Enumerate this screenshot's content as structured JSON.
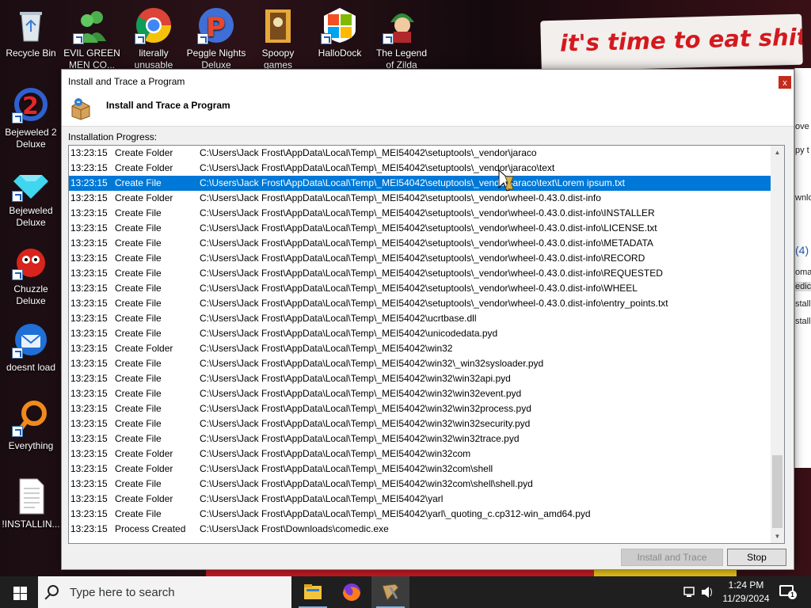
{
  "desktop": {
    "wallpaper_text": "it's time to eat shit",
    "icons": [
      {
        "label": "Recycle Bin"
      },
      {
        "label": "EVIL GREEN MEN CO..."
      },
      {
        "label": "literally unusable"
      },
      {
        "label": "Peggle Nights Deluxe"
      },
      {
        "label": "Spoopy games"
      },
      {
        "label": "HalloDock"
      },
      {
        "label": "The Legend of Zilda"
      },
      {
        "label": "Bejeweled 2 Deluxe"
      },
      {
        "label": "Bejeweled Deluxe"
      },
      {
        "label": "Chuzzle Deluxe"
      },
      {
        "label": "doesnt load"
      },
      {
        "label": "Everything"
      },
      {
        "label": "!INSTALLIN..."
      }
    ],
    "bg_window_fragments": [
      "ove t",
      "py t",
      "wnlo",
      "(4)",
      "oma",
      "edic",
      "stall",
      "stall"
    ]
  },
  "dialog": {
    "title": "Install and Trace a Program",
    "close_label": "x",
    "header_title": "Install and Trace a Program",
    "progress_label": "Installation Progress:",
    "selected_index": 2,
    "rows": [
      [
        "13:23:15",
        "Create Folder",
        "C:\\Users\\Jack Frost\\AppData\\Local\\Temp\\_MEI54042\\setuptools\\_vendor\\jaraco"
      ],
      [
        "13:23:15",
        "Create Folder",
        "C:\\Users\\Jack Frost\\AppData\\Local\\Temp\\_MEI54042\\setuptools\\_vendor\\jaraco\\text"
      ],
      [
        "13:23:15",
        "Create File",
        "C:\\Users\\Jack Frost\\AppData\\Local\\Temp\\_MEI54042\\setuptools\\_vendor\\jaraco\\text\\Lorem ipsum.txt"
      ],
      [
        "13:23:15",
        "Create Folder",
        "C:\\Users\\Jack Frost\\AppData\\Local\\Temp\\_MEI54042\\setuptools\\_vendor\\wheel-0.43.0.dist-info"
      ],
      [
        "13:23:15",
        "Create File",
        "C:\\Users\\Jack Frost\\AppData\\Local\\Temp\\_MEI54042\\setuptools\\_vendor\\wheel-0.43.0.dist-info\\INSTALLER"
      ],
      [
        "13:23:15",
        "Create File",
        "C:\\Users\\Jack Frost\\AppData\\Local\\Temp\\_MEI54042\\setuptools\\_vendor\\wheel-0.43.0.dist-info\\LICENSE.txt"
      ],
      [
        "13:23:15",
        "Create File",
        "C:\\Users\\Jack Frost\\AppData\\Local\\Temp\\_MEI54042\\setuptools\\_vendor\\wheel-0.43.0.dist-info\\METADATA"
      ],
      [
        "13:23:15",
        "Create File",
        "C:\\Users\\Jack Frost\\AppData\\Local\\Temp\\_MEI54042\\setuptools\\_vendor\\wheel-0.43.0.dist-info\\RECORD"
      ],
      [
        "13:23:15",
        "Create File",
        "C:\\Users\\Jack Frost\\AppData\\Local\\Temp\\_MEI54042\\setuptools\\_vendor\\wheel-0.43.0.dist-info\\REQUESTED"
      ],
      [
        "13:23:15",
        "Create File",
        "C:\\Users\\Jack Frost\\AppData\\Local\\Temp\\_MEI54042\\setuptools\\_vendor\\wheel-0.43.0.dist-info\\WHEEL"
      ],
      [
        "13:23:15",
        "Create File",
        "C:\\Users\\Jack Frost\\AppData\\Local\\Temp\\_MEI54042\\setuptools\\_vendor\\wheel-0.43.0.dist-info\\entry_points.txt"
      ],
      [
        "13:23:15",
        "Create File",
        "C:\\Users\\Jack Frost\\AppData\\Local\\Temp\\_MEI54042\\ucrtbase.dll"
      ],
      [
        "13:23:15",
        "Create File",
        "C:\\Users\\Jack Frost\\AppData\\Local\\Temp\\_MEI54042\\unicodedata.pyd"
      ],
      [
        "13:23:15",
        "Create Folder",
        "C:\\Users\\Jack Frost\\AppData\\Local\\Temp\\_MEI54042\\win32"
      ],
      [
        "13:23:15",
        "Create File",
        "C:\\Users\\Jack Frost\\AppData\\Local\\Temp\\_MEI54042\\win32\\_win32sysloader.pyd"
      ],
      [
        "13:23:15",
        "Create File",
        "C:\\Users\\Jack Frost\\AppData\\Local\\Temp\\_MEI54042\\win32\\win32api.pyd"
      ],
      [
        "13:23:15",
        "Create File",
        "C:\\Users\\Jack Frost\\AppData\\Local\\Temp\\_MEI54042\\win32\\win32event.pyd"
      ],
      [
        "13:23:15",
        "Create File",
        "C:\\Users\\Jack Frost\\AppData\\Local\\Temp\\_MEI54042\\win32\\win32process.pyd"
      ],
      [
        "13:23:15",
        "Create File",
        "C:\\Users\\Jack Frost\\AppData\\Local\\Temp\\_MEI54042\\win32\\win32security.pyd"
      ],
      [
        "13:23:15",
        "Create File",
        "C:\\Users\\Jack Frost\\AppData\\Local\\Temp\\_MEI54042\\win32\\win32trace.pyd"
      ],
      [
        "13:23:15",
        "Create Folder",
        "C:\\Users\\Jack Frost\\AppData\\Local\\Temp\\_MEI54042\\win32com"
      ],
      [
        "13:23:15",
        "Create Folder",
        "C:\\Users\\Jack Frost\\AppData\\Local\\Temp\\_MEI54042\\win32com\\shell"
      ],
      [
        "13:23:15",
        "Create File",
        "C:\\Users\\Jack Frost\\AppData\\Local\\Temp\\_MEI54042\\win32com\\shell\\shell.pyd"
      ],
      [
        "13:23:15",
        "Create Folder",
        "C:\\Users\\Jack Frost\\AppData\\Local\\Temp\\_MEI54042\\yarl"
      ],
      [
        "13:23:15",
        "Create File",
        "C:\\Users\\Jack Frost\\AppData\\Local\\Temp\\_MEI54042\\yarl\\_quoting_c.cp312-win_amd64.pyd"
      ],
      [
        "13:23:15",
        "Process Created",
        "C:\\Users\\Jack Frost\\Downloads\\comedic.exe"
      ]
    ],
    "buttons": {
      "install": "Install and Trace",
      "stop": "Stop"
    }
  },
  "taskbar": {
    "search_placeholder": "Type here to search",
    "apps": [
      "file-explorer",
      "firefox",
      "install-trace-app"
    ],
    "time": "1:24 PM",
    "date": "11/29/2024",
    "notification_count": "1"
  },
  "colors": {
    "selection": "#0078d7",
    "close_button": "#c42b1c",
    "taskbar": "#1f1f20"
  }
}
